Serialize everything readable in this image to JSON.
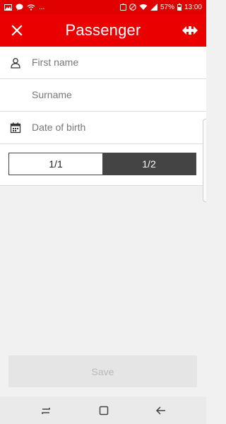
{
  "status_bar": {
    "battery": "57%",
    "time": "13:00",
    "ellipsis": "..."
  },
  "app_bar": {
    "title": "Passenger"
  },
  "form": {
    "first_name_placeholder": "First name",
    "surname_placeholder": "Surname",
    "date_of_birth_placeholder": "Date of birth",
    "fare_options": [
      "1/1",
      "1/2"
    ],
    "selected_fare": "1/2"
  },
  "save_label": "Save",
  "colors": {
    "brand_red": "#eb0000",
    "segment_active": "#444444",
    "disabled_button": "#e5e5e5"
  },
  "icons": [
    "close-icon",
    "sbb-logo-icon",
    "person-icon",
    "calendar-icon",
    "recents-icon",
    "home-icon",
    "back-icon"
  ]
}
